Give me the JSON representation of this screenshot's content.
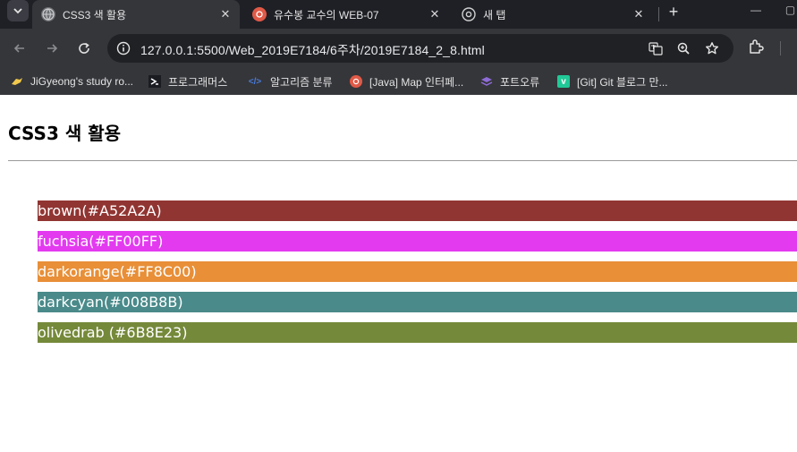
{
  "tabs": [
    {
      "title": "CSS3 색 활용",
      "active": true,
      "icon": "globe-icon"
    },
    {
      "title": "유수봉 교수의 WEB-07",
      "active": false,
      "icon": "app-icon"
    },
    {
      "title": "새 탭",
      "active": false,
      "icon": "chrome-icon"
    }
  ],
  "toolbar": {
    "url": "127.0.0.1:5500/Web_2019E7184/6주차/2019E7184_2_8.html"
  },
  "bookmarks": [
    {
      "label": "JiGyeong's study ro...",
      "icon": "bird-icon",
      "icon_color": "#f2c94c"
    },
    {
      "label": "프로그래머스",
      "icon": "programmers-icon",
      "icon_color": "#ffffff"
    },
    {
      "label": "알고리즘 분류",
      "icon": "code-icon",
      "icon_color": "#4a7bd8"
    },
    {
      "label": "[Java] Map 인터페...",
      "icon": "app-icon",
      "icon_color": "#e05a47"
    },
    {
      "label": "포트오류",
      "icon": "stack-icon",
      "icon_color": "#8e6bd6"
    },
    {
      "label": "[Git] Git 블로그 만...",
      "icon": "velog-icon",
      "icon_color": "#20c997"
    }
  ],
  "page": {
    "title": "CSS3 색 활용",
    "colors": [
      {
        "label": "brown(#A52A2A)",
        "color": "#913532"
      },
      {
        "label": "fuchsia(#FF00FF)",
        "color": "#e33af0"
      },
      {
        "label": "darkorange(#FF8C00)",
        "color": "#e88f38"
      },
      {
        "label": "darkcyan(#008B8B)",
        "color": "#4a8a8a"
      },
      {
        "label": "olivedrab (#6B8E23)",
        "color": "#75893a"
      }
    ]
  }
}
